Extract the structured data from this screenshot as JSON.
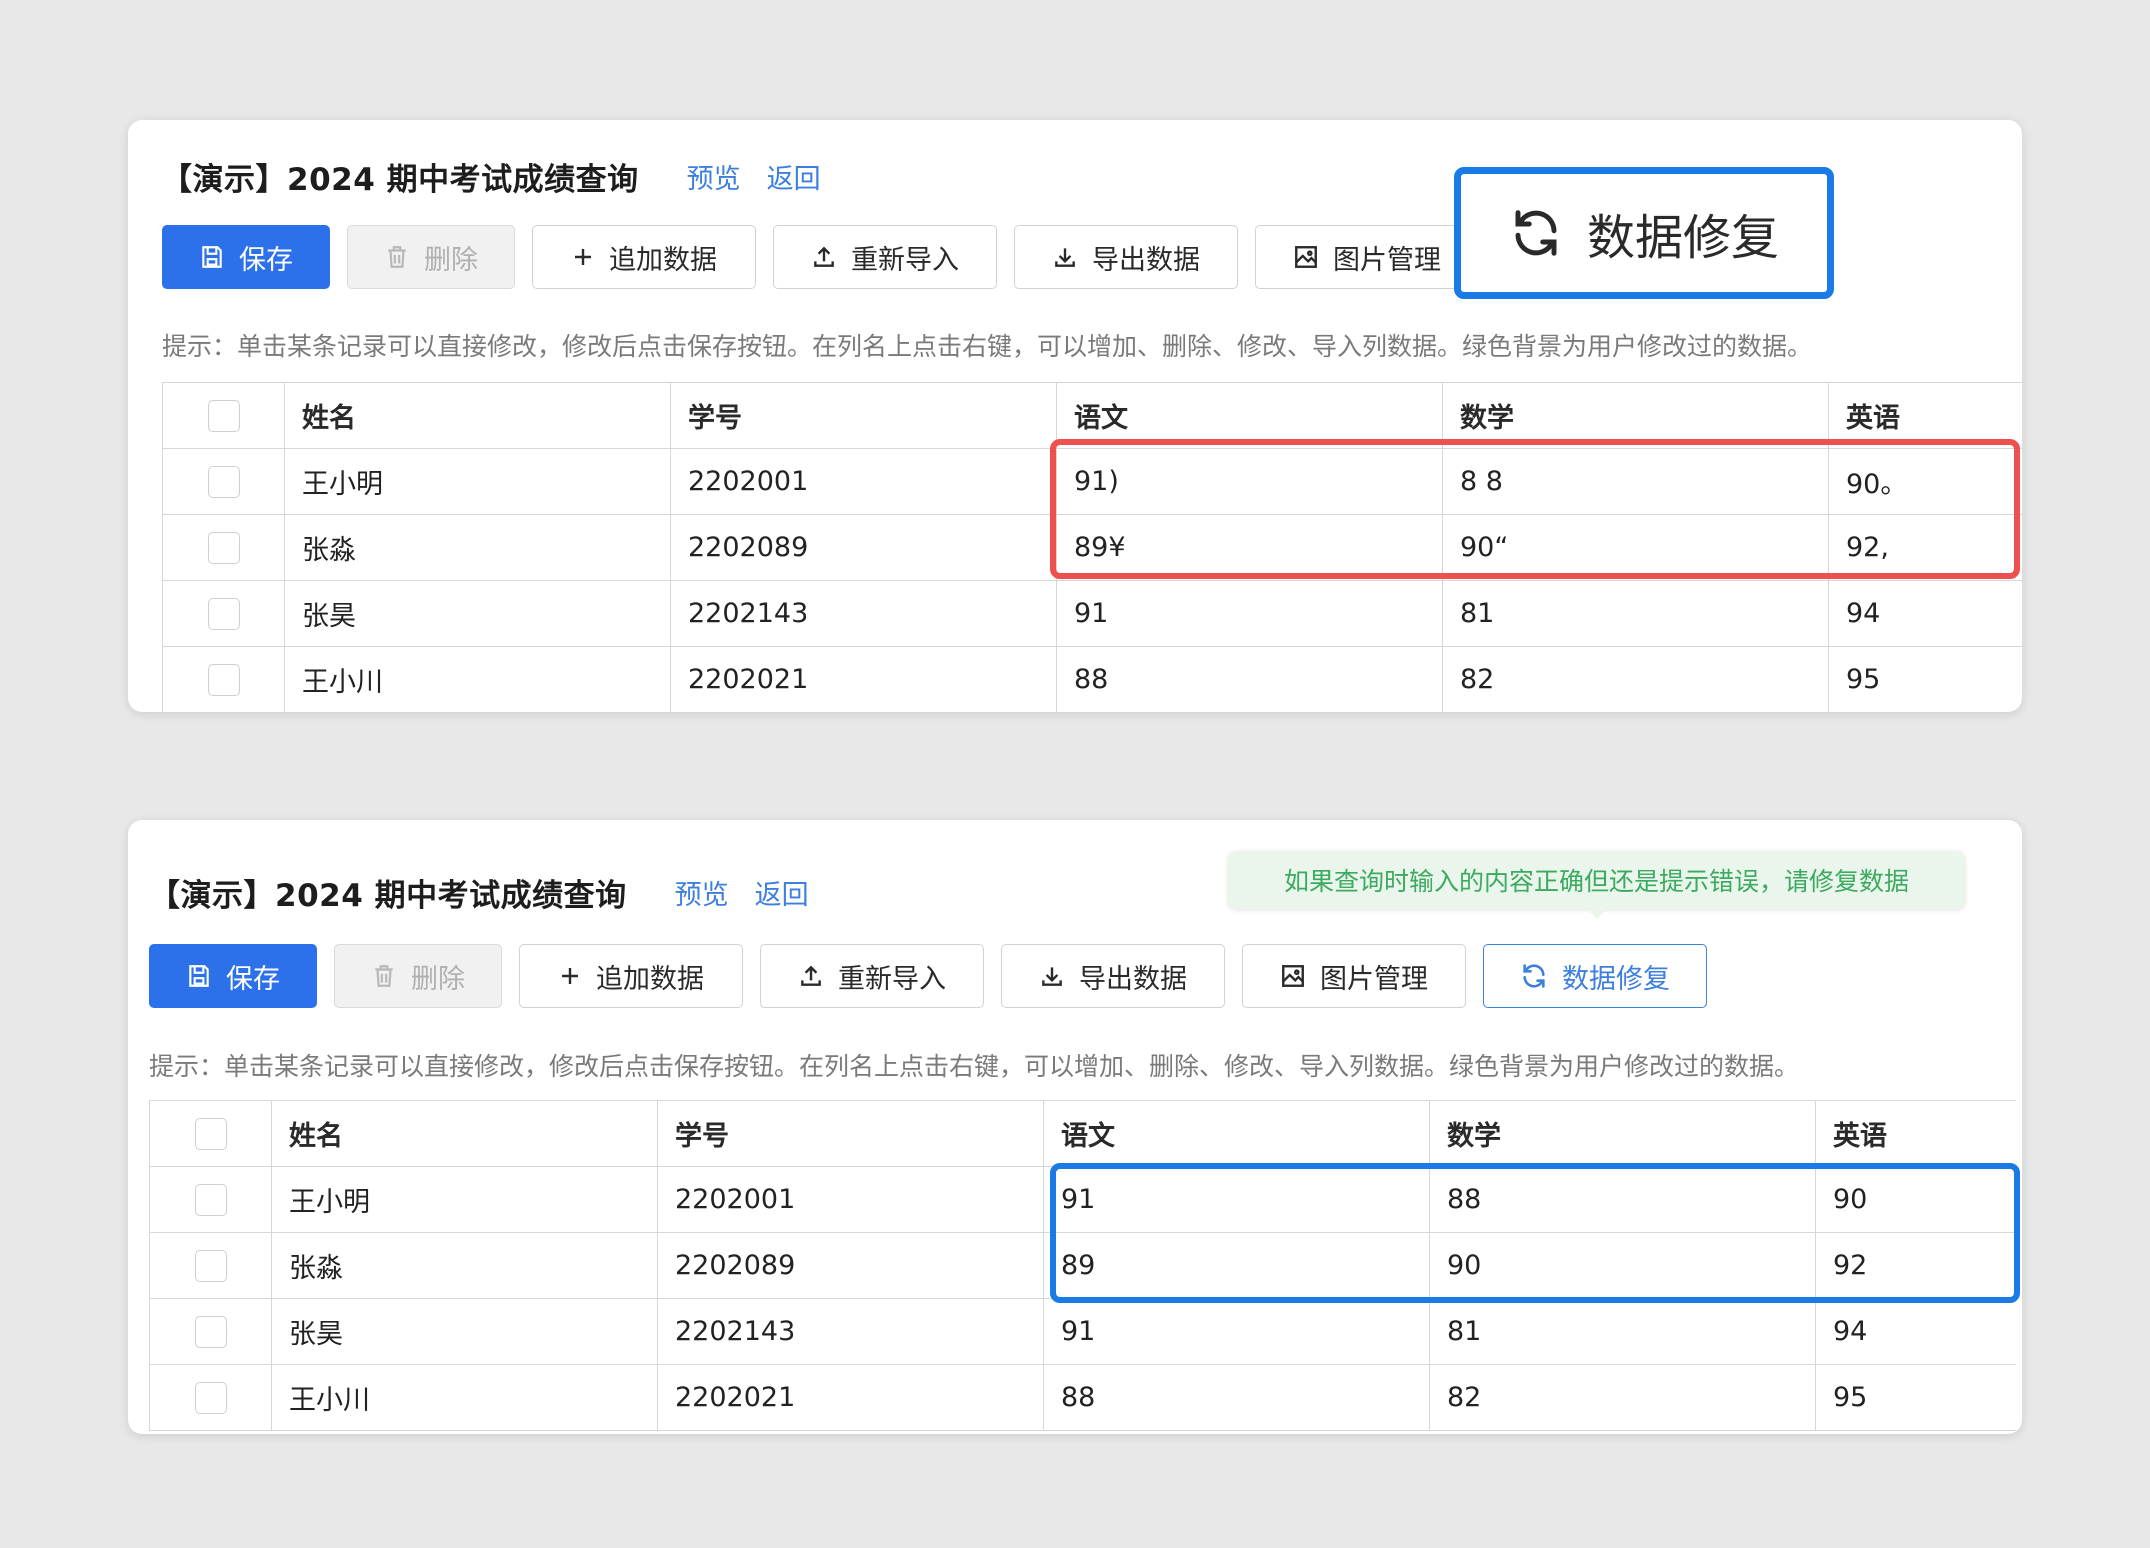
{
  "panels": [
    {
      "title": "【演示】2024 期中考试成绩查询",
      "links": [
        "预览",
        "返回"
      ],
      "toolbar": {
        "save": "保存",
        "delete": "删除",
        "add": "追加数据",
        "reimport": "重新导入",
        "export": "导出数据",
        "images": "图片管理"
      },
      "hint": "提示：单击某条记录可以直接修改，修改后点击保存按钮。在列名上点击右键，可以增加、删除、修改、导入列数据。绿色背景为用户修改过的数据。",
      "columns": [
        "姓名",
        "学号",
        "语文",
        "数学",
        "英语"
      ],
      "rows": [
        [
          "王小明",
          "2202001",
          "91)",
          "8 8",
          "90。"
        ],
        [
          "张淼",
          "2202089",
          "89¥",
          "90“",
          "92,"
        ],
        [
          "张昊",
          "2202143",
          "91",
          "81",
          "94"
        ],
        [
          "王小川",
          "2202021",
          "88",
          "82",
          "95"
        ]
      ]
    },
    {
      "title": "【演示】2024 期中考试成绩查询",
      "links": [
        "预览",
        "返回"
      ],
      "toolbar": {
        "save": "保存",
        "delete": "删除",
        "add": "追加数据",
        "reimport": "重新导入",
        "export": "导出数据",
        "images": "图片管理",
        "repair": "数据修复"
      },
      "hint": "提示：单击某条记录可以直接修改，修改后点击保存按钮。在列名上点击右键，可以增加、删除、修改、导入列数据。绿色背景为用户修改过的数据。",
      "columns": [
        "姓名",
        "学号",
        "语文",
        "数学",
        "英语"
      ],
      "rows": [
        [
          "王小明",
          "2202001",
          "91",
          "88",
          "90"
        ],
        [
          "张淼",
          "2202089",
          "89",
          "90",
          "92"
        ],
        [
          "张昊",
          "2202143",
          "91",
          "81",
          "94"
        ],
        [
          "王小川",
          "2202021",
          "88",
          "82",
          "95"
        ]
      ]
    }
  ],
  "zoom_button": {
    "label": "数据修复",
    "icon": "refresh-icon"
  },
  "tooltip": "如果查询时输入的内容正确但还是提示错误，请修复数据",
  "colors": {
    "primary": "#2d71ea",
    "link": "#3d7fe0",
    "highlight_red": "#ee5050",
    "highlight_blue": "#1a7be6",
    "tooltip_bg": "#eaf5ec",
    "tooltip_text": "#3caa60"
  }
}
